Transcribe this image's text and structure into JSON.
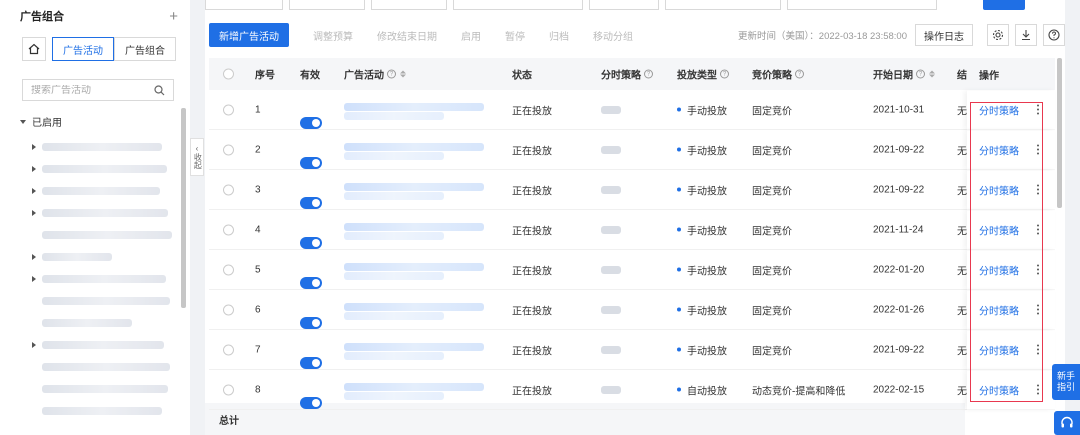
{
  "sidebar": {
    "title": "广告组合",
    "tabs": [
      {
        "label": "广告活动",
        "active": true
      },
      {
        "label": "广告组合",
        "active": false
      }
    ],
    "search_placeholder": "搜索广告活动",
    "group_label": "已启用",
    "collapse_label": "收起"
  },
  "toolbar": {
    "new_campaign": "新增广告活动",
    "actions": [
      "调整预算",
      "修改结束日期",
      "启用",
      "暂停",
      "归档",
      "移动分组"
    ],
    "updated_text": "更新时间（美国）：2022-03-18 23:58:00",
    "log_button": "操作日志"
  },
  "table": {
    "headers": {
      "seq": "序号",
      "enabled": "有效",
      "campaign": "广告活动",
      "status": "状态",
      "dayparting": "分时策略",
      "targeting": "投放类型",
      "bidding": "竞价策略",
      "start_date": "开始日期",
      "end_cut": "结",
      "actions": "操作"
    },
    "rows": [
      {
        "seq": "1",
        "status": "正在投放",
        "targeting": "手动投放",
        "bidding": "固定竞价",
        "start_date": "2021-10-31",
        "end_cut": "无",
        "action": "分时策略"
      },
      {
        "seq": "2",
        "status": "正在投放",
        "targeting": "手动投放",
        "bidding": "固定竞价",
        "start_date": "2021-09-22",
        "end_cut": "无",
        "action": "分时策略"
      },
      {
        "seq": "3",
        "status": "正在投放",
        "targeting": "手动投放",
        "bidding": "固定竞价",
        "start_date": "2021-09-22",
        "end_cut": "无",
        "action": "分时策略"
      },
      {
        "seq": "4",
        "status": "正在投放",
        "targeting": "手动投放",
        "bidding": "固定竞价",
        "start_date": "2021-11-24",
        "end_cut": "无",
        "action": "分时策略"
      },
      {
        "seq": "5",
        "status": "正在投放",
        "targeting": "手动投放",
        "bidding": "固定竞价",
        "start_date": "2022-01-20",
        "end_cut": "无",
        "action": "分时策略"
      },
      {
        "seq": "6",
        "status": "正在投放",
        "targeting": "手动投放",
        "bidding": "固定竞价",
        "start_date": "2022-01-26",
        "end_cut": "无",
        "action": "分时策略"
      },
      {
        "seq": "7",
        "status": "正在投放",
        "targeting": "手动投放",
        "bidding": "固定竞价",
        "start_date": "2021-09-22",
        "end_cut": "无",
        "action": "分时策略"
      },
      {
        "seq": "8",
        "status": "正在投放",
        "targeting": "自动投放",
        "bidding": "动态竞价-提高和降低",
        "start_date": "2022-02-15",
        "end_cut": "无",
        "action": "分时策略"
      }
    ],
    "total_label": "总计"
  },
  "helper": {
    "line1": "新手",
    "line2": "指引"
  },
  "colors": {
    "accent": "#1f6fe5",
    "highlight_box": "#e8384f"
  }
}
